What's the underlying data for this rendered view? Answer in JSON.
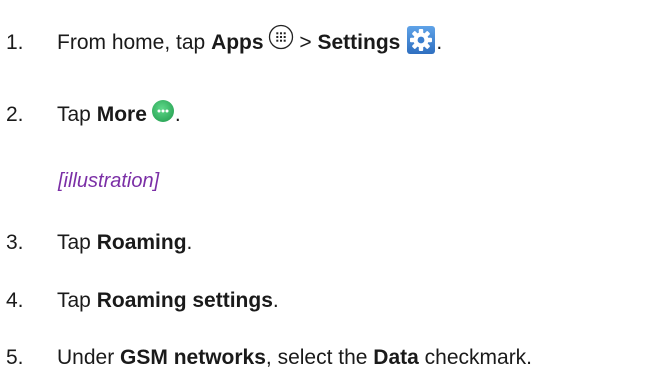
{
  "steps": [
    {
      "number": "1.",
      "parts": [
        "From home, tap ",
        "Apps",
        " > ",
        "Settings",
        "."
      ],
      "icons": [
        "apps-grid-icon",
        "settings-gear-icon"
      ]
    },
    {
      "number": "2.",
      "parts": [
        "Tap ",
        "More",
        "."
      ],
      "icons": [
        "more-dots-icon"
      ]
    },
    {
      "number": "3.",
      "parts": [
        "Tap ",
        "Roaming",
        "."
      ]
    },
    {
      "number": "4.",
      "parts": [
        "Tap ",
        "Roaming settings",
        "."
      ]
    },
    {
      "number": "5.",
      "parts": [
        "Under ",
        "GSM networks",
        ", select the ",
        "Data",
        " checkmark."
      ]
    }
  ],
  "illustration_placeholder": "[illustration]",
  "colors": {
    "text": "#1a1a1a",
    "placeholder": "#7b2fa6",
    "settings_icon": "#3a7fd0",
    "more_icon": "#3fbf6a"
  }
}
